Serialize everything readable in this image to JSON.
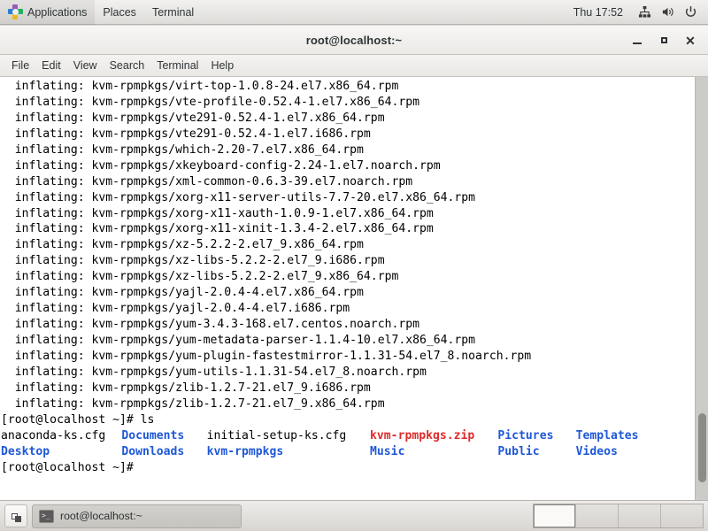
{
  "top_panel": {
    "logo_icon": "centos-logo-icon",
    "menus": [
      "Applications",
      "Places",
      "Terminal"
    ],
    "clock": "Thu 17:52",
    "tray": [
      {
        "name": "network-icon",
        "glyph": "network"
      },
      {
        "name": "volume-icon",
        "glyph": "volume"
      },
      {
        "name": "power-icon",
        "glyph": "power"
      }
    ]
  },
  "window": {
    "title": "root@localhost:~",
    "controls": {
      "minimize": "minimize-button",
      "maximize": "maximize-button",
      "close": "close-button"
    },
    "menu_bar": [
      "File",
      "Edit",
      "View",
      "Search",
      "Terminal",
      "Help"
    ]
  },
  "terminal": {
    "prompt": "[root@localhost ~]#",
    "lines": [
      {
        "text": "  inflating: kvm-rpmpkgs/virt-top-1.0.8-24.el7.x86_64.rpm"
      },
      {
        "text": "  inflating: kvm-rpmpkgs/vte-profile-0.52.4-1.el7.x86_64.rpm"
      },
      {
        "text": "  inflating: kvm-rpmpkgs/vte291-0.52.4-1.el7.x86_64.rpm"
      },
      {
        "text": "  inflating: kvm-rpmpkgs/vte291-0.52.4-1.el7.i686.rpm"
      },
      {
        "text": "  inflating: kvm-rpmpkgs/which-2.20-7.el7.x86_64.rpm"
      },
      {
        "text": "  inflating: kvm-rpmpkgs/xkeyboard-config-2.24-1.el7.noarch.rpm"
      },
      {
        "text": "  inflating: kvm-rpmpkgs/xml-common-0.6.3-39.el7.noarch.rpm"
      },
      {
        "text": "  inflating: kvm-rpmpkgs/xorg-x11-server-utils-7.7-20.el7.x86_64.rpm"
      },
      {
        "text": "  inflating: kvm-rpmpkgs/xorg-x11-xauth-1.0.9-1.el7.x86_64.rpm"
      },
      {
        "text": "  inflating: kvm-rpmpkgs/xorg-x11-xinit-1.3.4-2.el7.x86_64.rpm"
      },
      {
        "text": "  inflating: kvm-rpmpkgs/xz-5.2.2-2.el7_9.x86_64.rpm"
      },
      {
        "text": "  inflating: kvm-rpmpkgs/xz-libs-5.2.2-2.el7_9.i686.rpm"
      },
      {
        "text": "  inflating: kvm-rpmpkgs/xz-libs-5.2.2-2.el7_9.x86_64.rpm"
      },
      {
        "text": "  inflating: kvm-rpmpkgs/yajl-2.0.4-4.el7.x86_64.rpm"
      },
      {
        "text": "  inflating: kvm-rpmpkgs/yajl-2.0.4-4.el7.i686.rpm"
      },
      {
        "text": "  inflating: kvm-rpmpkgs/yum-3.4.3-168.el7.centos.noarch.rpm"
      },
      {
        "text": "  inflating: kvm-rpmpkgs/yum-metadata-parser-1.1.4-10.el7.x86_64.rpm"
      },
      {
        "text": "  inflating: kvm-rpmpkgs/yum-plugin-fastestmirror-1.1.31-54.el7_8.noarch.rpm"
      },
      {
        "text": "  inflating: kvm-rpmpkgs/yum-utils-1.1.31-54.el7_8.noarch.rpm"
      },
      {
        "text": "  inflating: kvm-rpmpkgs/zlib-1.2.7-21.el7_9.i686.rpm"
      },
      {
        "text": "  inflating: kvm-rpmpkgs/zlib-1.2.7-21.el7_9.x86_64.rpm"
      }
    ],
    "command_line": "[root@localhost ~]# ls",
    "ls_output_rows": [
      [
        {
          "text": "anaconda-ks.cfg",
          "color": "default",
          "col": 0
        },
        {
          "text": "Documents",
          "color": "blue",
          "col": 17
        },
        {
          "text": "initial-setup-ks.cfg",
          "color": "default",
          "col": 29
        },
        {
          "text": "kvm-rpmpkgs.zip",
          "color": "red",
          "col": 52
        },
        {
          "text": "Pictures",
          "color": "blue",
          "col": 70
        },
        {
          "text": "Templates",
          "color": "blue",
          "col": 81
        }
      ],
      [
        {
          "text": "Desktop",
          "color": "blue",
          "col": 0
        },
        {
          "text": "Downloads",
          "color": "blue",
          "col": 17
        },
        {
          "text": "kvm-rpmpkgs",
          "color": "blue",
          "col": 29
        },
        {
          "text": "Music",
          "color": "blue",
          "col": 52
        },
        {
          "text": "Public",
          "color": "blue",
          "col": 70
        },
        {
          "text": "Videos",
          "color": "blue",
          "col": 81
        }
      ]
    ],
    "final_prompt": "[root@localhost ~]#",
    "colors": {
      "background": "#ffffff",
      "foreground": "#000000",
      "directory_blue": "#1f58d8",
      "archive_red": "#e02b2b"
    }
  },
  "taskbar": {
    "show_desktop": "show-desktop-button",
    "window_button": "root@localhost:~",
    "workspaces": [
      {
        "active": true
      },
      {
        "active": false
      },
      {
        "active": false
      },
      {
        "active": false
      }
    ]
  }
}
